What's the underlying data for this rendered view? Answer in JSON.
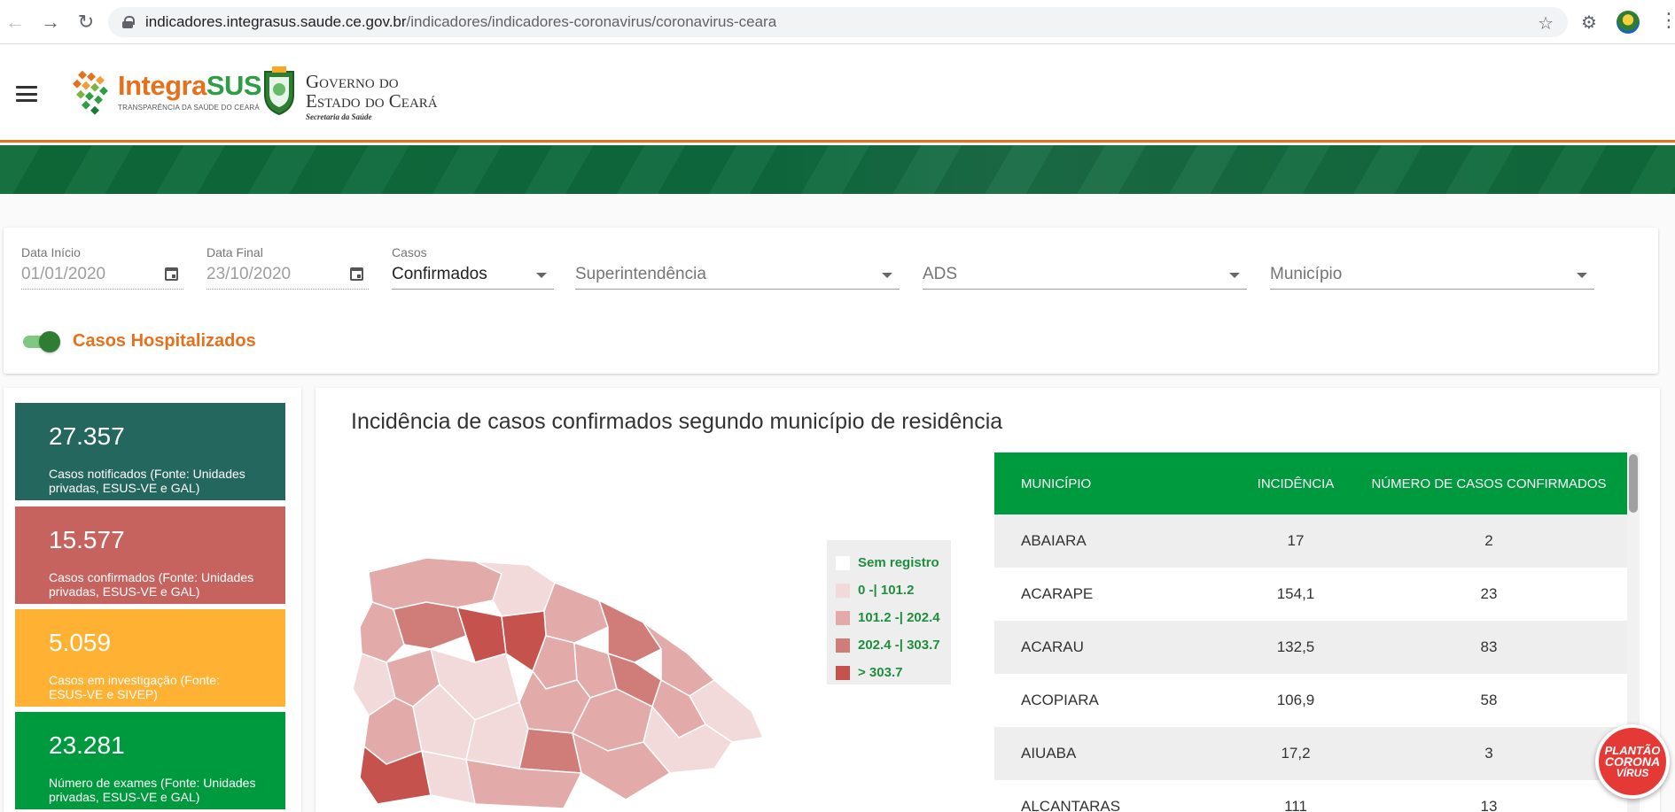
{
  "browser": {
    "url_host": "indicadores.integrasus.saude.ce.gov.br",
    "url_path": "/indicadores/indicadores-coronavirus/coronavirus-ceara"
  },
  "header": {
    "brand_prefix": "Integra",
    "brand_suffix": "SUS",
    "brand_tagline": "TRANSPARÊNCIA DA SAÚDE DO CEARÁ",
    "gov_line1": "Governo do",
    "gov_line2": "Estado do Ceará",
    "gov_line3": "Secretaria da Saúde"
  },
  "filters": {
    "start_date": {
      "label": "Data Início",
      "value": "01/01/2020"
    },
    "end_date": {
      "label": "Data Final",
      "value": "23/10/2020"
    },
    "casos": {
      "label": "Casos",
      "value": "Confirmados"
    },
    "superintendencia": {
      "placeholder": "Superintendência"
    },
    "ads": {
      "placeholder": "ADS"
    },
    "municipio": {
      "placeholder": "Município"
    },
    "toggle": {
      "label": "Casos Hospitalizados",
      "on": true
    }
  },
  "stats": [
    {
      "value": "27.357",
      "label": "Casos notificados (Fonte: Unidades privadas, ESUS-VE e GAL)",
      "color": "#24675e"
    },
    {
      "value": "15.577",
      "label": "Casos confirmados (Fonte: Unidades privadas, ESUS-VE e GAL)",
      "color": "#c7635f"
    },
    {
      "value": "5.059",
      "label": "Casos em investigação (Fonte: ESUS-VE e SIVEP)",
      "color": "#ffb133"
    },
    {
      "value": "23.281",
      "label": "Número de exames (Fonte: Unidades privadas, ESUS-VE e GAL)",
      "color": "#009a3e"
    }
  ],
  "main": {
    "title": "Incidência de casos confirmados segundo município de residência"
  },
  "legend": [
    {
      "label": "Sem registro",
      "color": "#ffffff"
    },
    {
      "label": "0 -| 101.2",
      "color": "#f3dada"
    },
    {
      "label": "101.2 -| 202.4",
      "color": "#e2aaa8"
    },
    {
      "label": "202.4 -| 303.7",
      "color": "#d07d79"
    },
    {
      "label": "> 303.7",
      "color": "#c5524d"
    }
  ],
  "table": {
    "headers": [
      "MUNICÍPIO",
      "INCIDÊNCIA",
      "NÚMERO DE CASOS CONFIRMADOS"
    ],
    "rows": [
      [
        "ABAIARA",
        "17",
        "2"
      ],
      [
        "ACARAPE",
        "154,1",
        "23"
      ],
      [
        "ACARAU",
        "132,5",
        "83"
      ],
      [
        "ACOPIARA",
        "106,9",
        "58"
      ],
      [
        "AIUABA",
        "17,2",
        "3"
      ],
      [
        "ALCANTARAS",
        "111",
        "13"
      ]
    ]
  },
  "fab": {
    "line1": "PLANTÃO",
    "line2": "CORONA",
    "line3": "VÍRUS"
  }
}
